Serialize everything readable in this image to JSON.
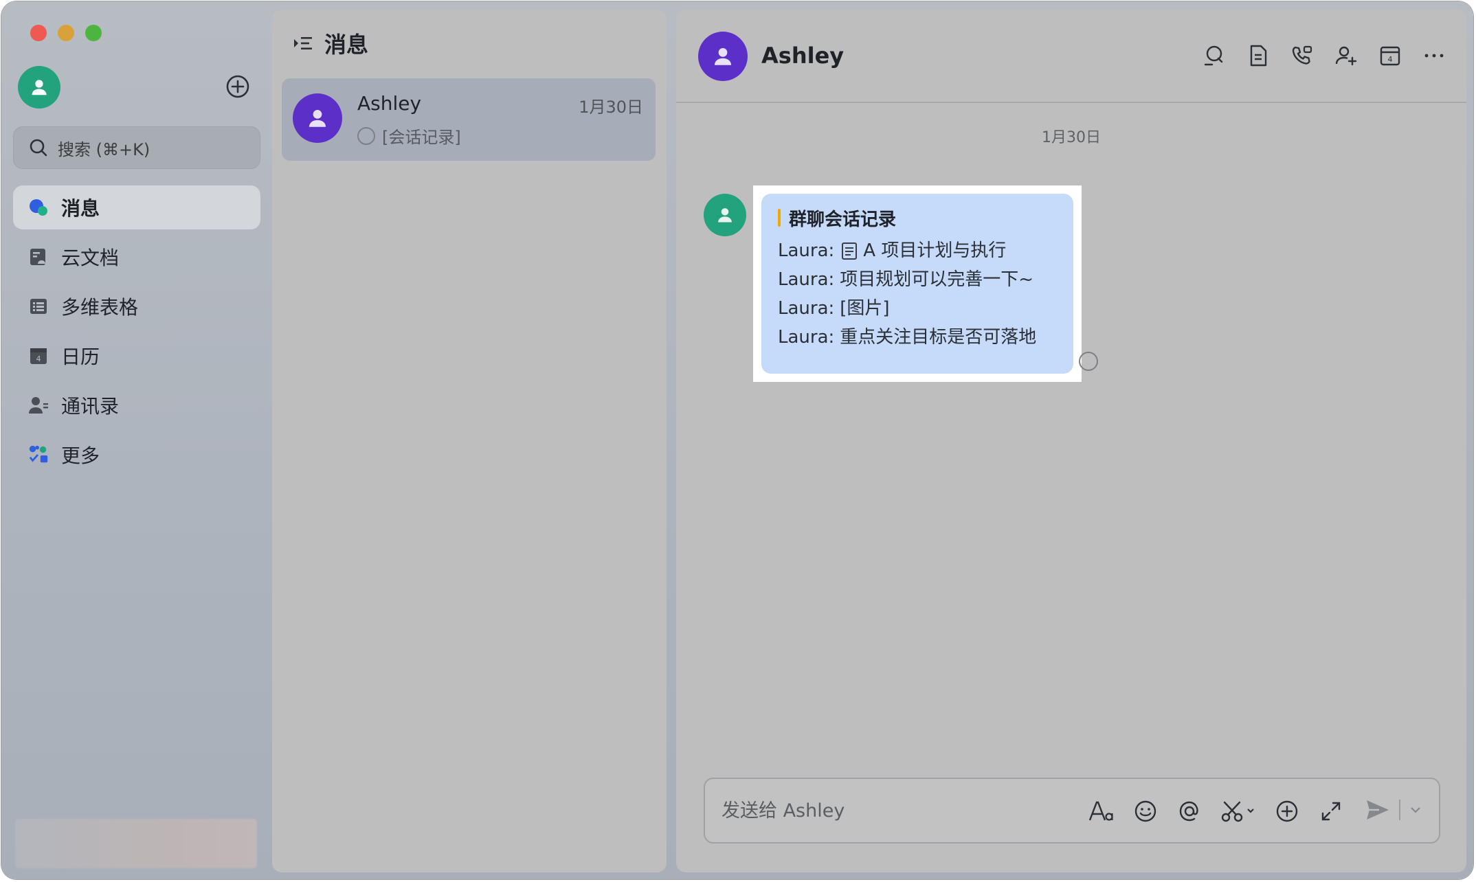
{
  "window": {
    "lights": [
      "close",
      "minimize",
      "zoom"
    ]
  },
  "sidebar": {
    "search": {
      "placeholder": "搜索 (⌘+K)"
    },
    "items": [
      {
        "label": "消息",
        "icon": "chat-bubble-icon",
        "active": true
      },
      {
        "label": "云文档",
        "icon": "cloud-doc-icon",
        "active": false
      },
      {
        "label": "多维表格",
        "icon": "table-icon",
        "active": false
      },
      {
        "label": "日历",
        "icon": "calendar-icon",
        "active": false
      },
      {
        "label": "通讯录",
        "icon": "contacts-icon",
        "active": false
      },
      {
        "label": "更多",
        "icon": "apps-grid-icon",
        "active": false
      }
    ]
  },
  "list": {
    "title": "消息",
    "conversations": [
      {
        "name": "Ashley",
        "time": "1月30日",
        "preview": "[会话记录]"
      }
    ]
  },
  "chat": {
    "title": "Ashley",
    "date": "1月30日",
    "message": {
      "card_title": "群聊会话记录",
      "lines": [
        {
          "sender": "Laura:",
          "text": "A 项目计划与执行",
          "has_doc_icon": true
        },
        {
          "sender": "Laura:",
          "text": "项目规划可以完善一下~"
        },
        {
          "sender": "Laura:",
          "text": "[图片]"
        },
        {
          "sender": "Laura:",
          "text": "重点关注目标是否可落地"
        }
      ]
    },
    "composer": {
      "placeholder": "发送给 Ashley"
    }
  },
  "colors": {
    "avatar_purple": "#5b2fc8",
    "avatar_green": "#22a37e",
    "bubble_blue": "#c6dafa",
    "accent_bar": "#f0a800"
  }
}
